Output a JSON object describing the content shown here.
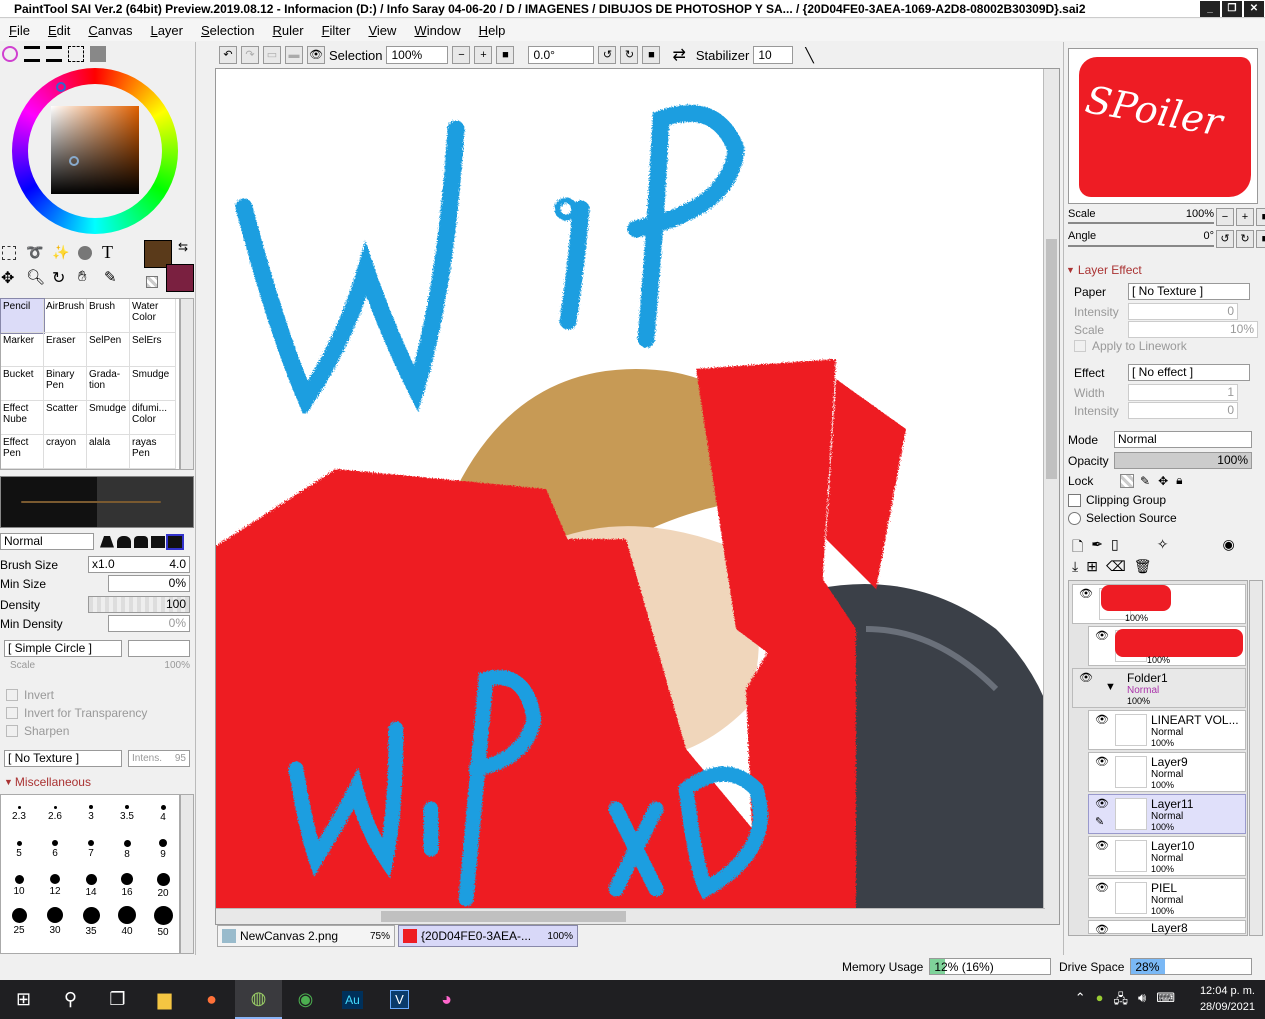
{
  "window": {
    "title": "PaintTool SAI Ver.2 (64bit) Preview.2019.08.12 - Informacion (D:) / Info Saray 04-06-20 / D / IMAGENES / DIBUJOS DE PHOTOSHOP Y SA... / {20D04FE0-3AEA-1069-A2D8-08002B30309D}.sai2"
  },
  "menu": [
    "File",
    "Edit",
    "Canvas",
    "Layer",
    "Selection",
    "Ruler",
    "Filter",
    "View",
    "Window",
    "Help"
  ],
  "toolbar": {
    "selection_label": "Selection",
    "zoom": "100%",
    "angle": "0.0°",
    "stabilizer_label": "Stabilizer",
    "stabilizer_value": "10"
  },
  "colors": {
    "primary": "#5a3a1a",
    "secondary": "#7a2040",
    "wip_blue": "#1a9ee0",
    "scribble_red": "#ee1c24"
  },
  "brushes": [
    [
      "Pencil",
      "AirBrush",
      "Brush",
      "Water Color"
    ],
    [
      "Marker",
      "Eraser",
      "SelPen",
      "SelErs"
    ],
    [
      "Bucket",
      "Binary Pen",
      "Grada- tion",
      "Smudge"
    ],
    [
      "Effect Nube",
      "Scatter",
      "Smudge",
      "difumi... Color"
    ],
    [
      "Effect Pen",
      "crayon",
      "alala",
      "rayas Pen"
    ]
  ],
  "brush_panel": {
    "blend_mode": "Normal",
    "size_label": "Brush Size",
    "size_mult": "x1.0",
    "size_value": "4.0",
    "min_size_label": "Min Size",
    "min_size_value": "0%",
    "density_label": "Density",
    "density_value": "100",
    "min_density_label": "Min Density",
    "min_density_value": "0%",
    "shape": "[ Simple Circle ]",
    "scale_label": "Scale",
    "scale_value": "100%",
    "invert": "Invert",
    "invert_transparency": "Invert for Transparency",
    "sharpen": "Sharpen",
    "texture": "[ No Texture ]",
    "intens_label": "Intens.",
    "intens_value": "95",
    "misc_label": "Miscellaneous"
  },
  "brush_sizes": [
    "2.3",
    "2.6",
    "3",
    "3.5",
    "4",
    "5",
    "6",
    "7",
    "8",
    "9",
    "10",
    "12",
    "14",
    "16",
    "20",
    "25",
    "30",
    "35",
    "40",
    "50"
  ],
  "navigator": {
    "preview_text": "SPoiler",
    "scale_label": "Scale",
    "scale_value": "100%",
    "angle_label": "Angle",
    "angle_value": "0°"
  },
  "layer_effect": {
    "header": "Layer Effect",
    "paper_label": "Paper",
    "paper_value": "[ No Texture ]",
    "intensity_label": "Intensity",
    "intensity_value": "0",
    "scale_label": "Scale",
    "scale_value": "10%",
    "apply_linework": "Apply to Linework",
    "effect_label": "Effect",
    "effect_value": "[ No effect ]",
    "width_label": "Width",
    "width_value": "1",
    "intensity2_label": "Intensity",
    "intensity2_value": "0"
  },
  "layer_props": {
    "mode_label": "Mode",
    "mode_value": "Normal",
    "opacity_label": "Opacity",
    "opacity_value": "100%",
    "lock_label": "Lock",
    "clipping": "Clipping Group",
    "selection_source": "Selection Source"
  },
  "layers": [
    {
      "name": "",
      "mode": "",
      "opacity": "100%"
    },
    {
      "name": "",
      "mode": "",
      "opacity": "100%"
    },
    {
      "name": "Folder1",
      "mode": "Normal",
      "opacity": "100%"
    },
    {
      "name": "LINEART VOL...",
      "mode": "Normal",
      "opacity": "100%"
    },
    {
      "name": "Layer9",
      "mode": "Normal",
      "opacity": "100%"
    },
    {
      "name": "Layer11",
      "mode": "Normal",
      "opacity": "100%"
    },
    {
      "name": "Layer10",
      "mode": "Normal",
      "opacity": "100%"
    },
    {
      "name": "PIEL",
      "mode": "Normal",
      "opacity": "100%"
    },
    {
      "name": "Layer8",
      "mode": "",
      "opacity": ""
    }
  ],
  "doc_tabs": [
    {
      "name": "NewCanvas 2.png",
      "zoom": "75%"
    },
    {
      "name": "{20D04FE0-3AEA-...",
      "zoom": "100%"
    }
  ],
  "status": {
    "memory_label": "Memory Usage",
    "memory_value": "12% (16%)",
    "memory_fraction": 0.12,
    "drive_label": "Drive Space",
    "drive_value": "28%",
    "drive_fraction": 0.28
  },
  "taskbar": {
    "time": "12:04 p. m.",
    "date": "28/09/2021"
  },
  "canvas_text": {
    "top": "WIP",
    "bottom": "wip xD"
  }
}
